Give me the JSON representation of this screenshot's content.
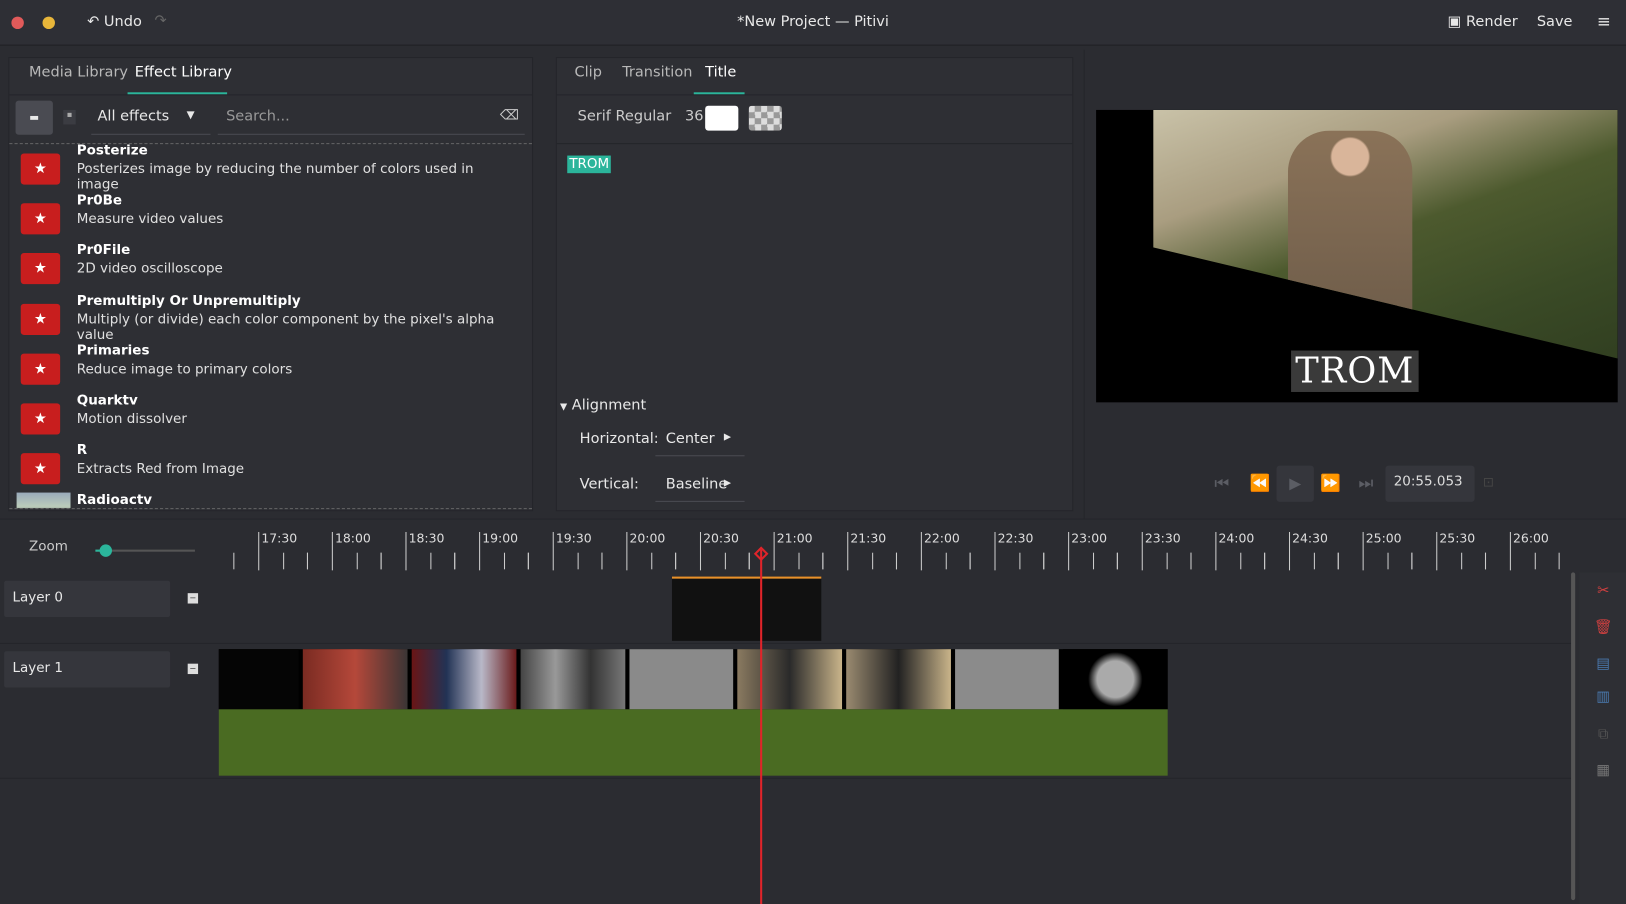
{
  "header": {
    "title": "*New Project — Pitivi",
    "undo_label": "Undo",
    "render_label": "Render",
    "save_label": "Save"
  },
  "left_panel": {
    "tabs": [
      {
        "label": "Media Library",
        "active": false
      },
      {
        "label": "Effect Library",
        "active": true
      }
    ],
    "category": "All effects",
    "search_placeholder": "Search...",
    "effects": [
      {
        "name": "Posterize",
        "description": "Posterizes image by reducing the number of colors used in image"
      },
      {
        "name": "Pr0Be",
        "description": "Measure video values"
      },
      {
        "name": "Pr0File",
        "description": "2D video oscilloscope"
      },
      {
        "name": "Premultiply Or Unpremultiply",
        "description": "Multiply (or divide) each color component by the pixel's alpha value"
      },
      {
        "name": "Primaries",
        "description": "Reduce image to primary colors"
      },
      {
        "name": "Quarktv",
        "description": "Motion dissolver"
      },
      {
        "name": "R",
        "description": "Extracts Red from Image"
      },
      {
        "name": "Radioactv",
        "description": ""
      }
    ]
  },
  "middle_panel": {
    "tabs": [
      {
        "label": "Clip",
        "active": false
      },
      {
        "label": "Transition",
        "active": false
      },
      {
        "label": "Title",
        "active": true
      }
    ],
    "font": "Serif Regular",
    "font_size": "36",
    "text": "TROM",
    "alignment": {
      "section": "Alignment",
      "horizontal_label": "Horizontal:",
      "horizontal": "Center",
      "vertical_label": "Vertical:",
      "vertical": "Baseline"
    }
  },
  "viewer": {
    "overlay_text": "TROM",
    "timecode": "20:55.053"
  },
  "timeline": {
    "zoom_label": "Zoom",
    "zoom_level": 0.1,
    "ruler": [
      "17:30",
      "18:00",
      "18:30",
      "19:00",
      "19:30",
      "20:00",
      "20:30",
      "21:00",
      "21:30",
      "22:00",
      "22:30",
      "23:00",
      "23:30",
      "24:00",
      "24:30",
      "25:00",
      "25:30",
      "26:00"
    ],
    "layers": [
      {
        "label": "Layer 0"
      },
      {
        "label": "Layer 1"
      }
    ]
  },
  "colors": {
    "accent": "#2bb59b",
    "playhead": "#e0242a",
    "audio": "#4a6b22"
  }
}
